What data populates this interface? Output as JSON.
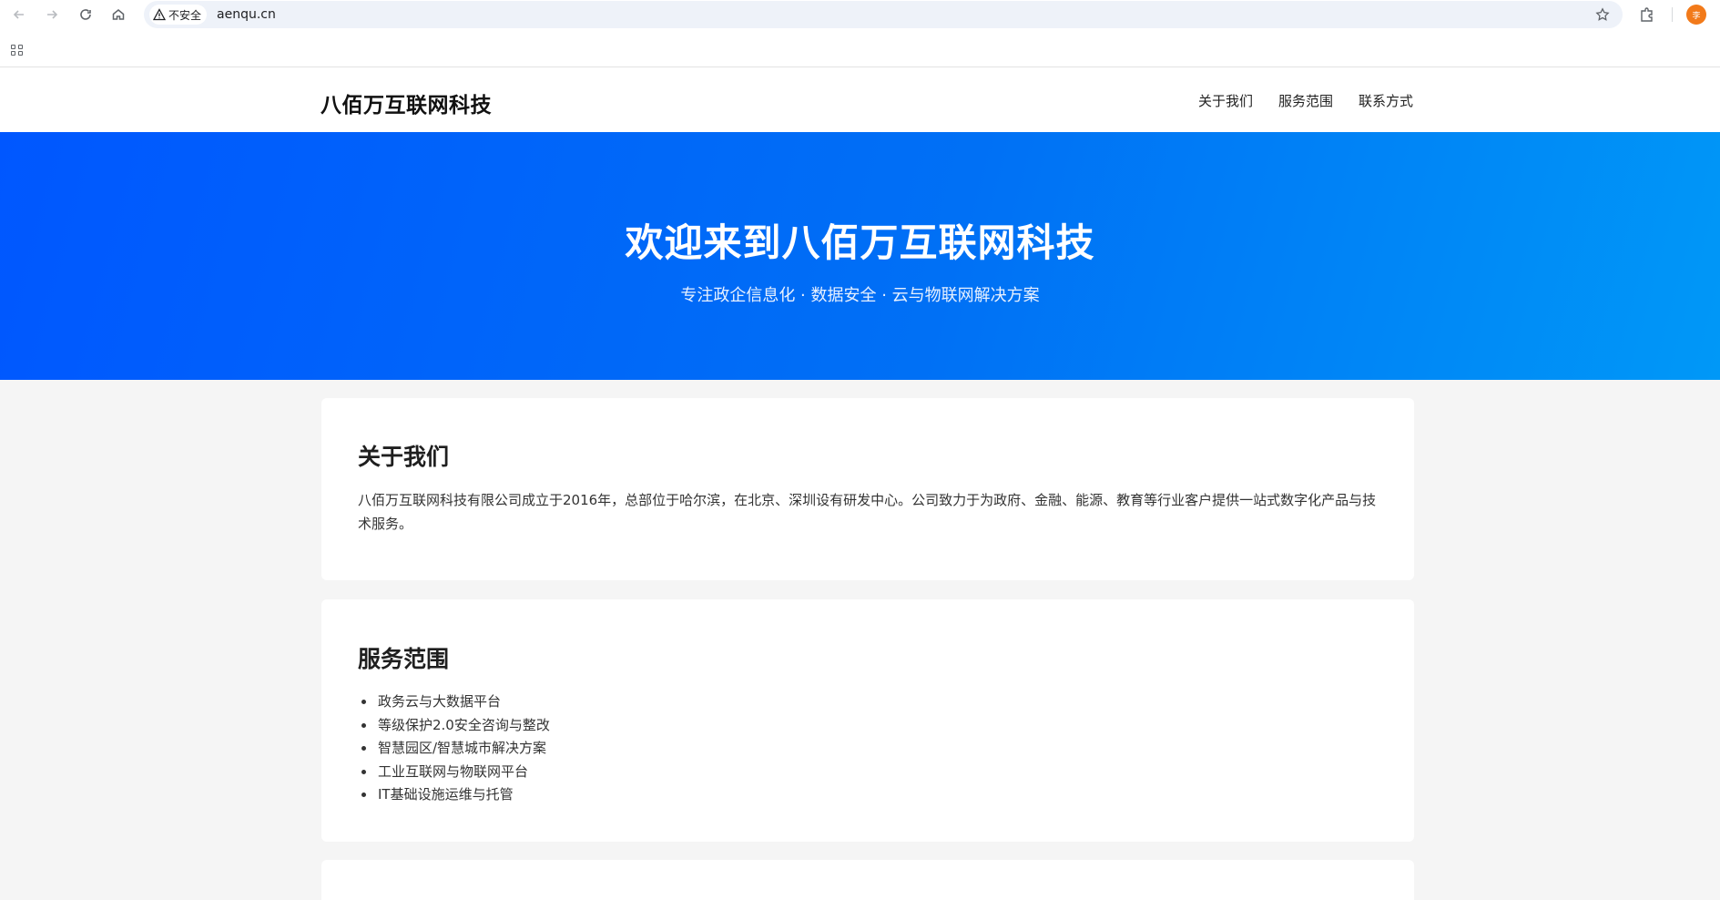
{
  "browser": {
    "security_label": "不安全",
    "url": "aenqu.cn",
    "avatar_initial": "李"
  },
  "site": {
    "logo": "八佰万互联网科技",
    "nav": [
      "关于我们",
      "服务范围",
      "联系方式"
    ]
  },
  "hero": {
    "title": "欢迎来到八佰万互联网科技",
    "subtitle": "专注政企信息化 · 数据安全 · 云与物联网解决方案",
    "gradient_start": "#0057ff",
    "gradient_end": "#0098f7"
  },
  "about": {
    "heading": "关于我们",
    "body": "八佰万互联网科技有限公司成立于2016年，总部位于哈尔滨，在北京、深圳设有研发中心。公司致力于为政府、金融、能源、教育等行业客户提供一站式数字化产品与技术服务。"
  },
  "services": {
    "heading": "服务范围",
    "items": [
      "政务云与大数据平台",
      "等级保护2.0安全咨询与整改",
      "智慧园区/智慧城市解决方案",
      "工业互联网与物联网平台",
      "IT基础设施运维与托管"
    ]
  }
}
